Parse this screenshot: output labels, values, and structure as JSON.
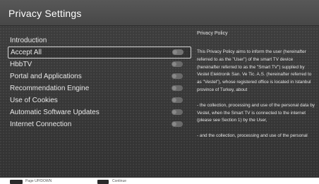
{
  "window": {
    "title": "Privacy Settings"
  },
  "menu": {
    "items": [
      {
        "label": "Introduction",
        "has_toggle": false,
        "selected": false
      },
      {
        "label": "Accept All",
        "has_toggle": true,
        "selected": true,
        "toggle_state": "off"
      },
      {
        "label": "HbbTV",
        "has_toggle": true,
        "selected": false,
        "toggle_state": "off"
      },
      {
        "label": "Portal and Applications",
        "has_toggle": true,
        "selected": false,
        "toggle_state": "off"
      },
      {
        "label": "Recommendation Engine",
        "has_toggle": true,
        "selected": false,
        "toggle_state": "off"
      },
      {
        "label": "Use of Cookies",
        "has_toggle": true,
        "selected": false,
        "toggle_state": "off"
      },
      {
        "label": "Automatic Software Updates",
        "has_toggle": true,
        "selected": false,
        "toggle_state": "off"
      },
      {
        "label": "Internet Connection",
        "has_toggle": true,
        "selected": false,
        "toggle_state": "off"
      }
    ]
  },
  "policy": {
    "heading": "Privacy Policy",
    "paragraphs": [
      "This Privacy Policy aims to inform the user (hereinafter referred to as the \"User\") of the smart TV device (hereinafter referred to as the \"Smart TV\") supplied by Vestel Elektronik San. Ve Tic. A.S. (hereinafter referred to as \"Vestel\"), whose registered office is located in Istanbul province of Turkey, about",
      "-  the collection, processing and use of the personal data by Vestel, when the Smart TV is connected to the internet (please see Section 1) by the User,",
      "-  and the collection, processing and use of the personal"
    ]
  },
  "footer": {
    "hints": [
      {
        "icon": "page-updown-icon",
        "label": "Page UP/DOWN"
      },
      {
        "icon": "ok-icon",
        "label": "Continue"
      }
    ]
  },
  "colors": {
    "background": "#3a3a3a",
    "title_bar": "#4e4e4e",
    "text": "#ffffff",
    "toggle_off": "#6a6a6a"
  }
}
